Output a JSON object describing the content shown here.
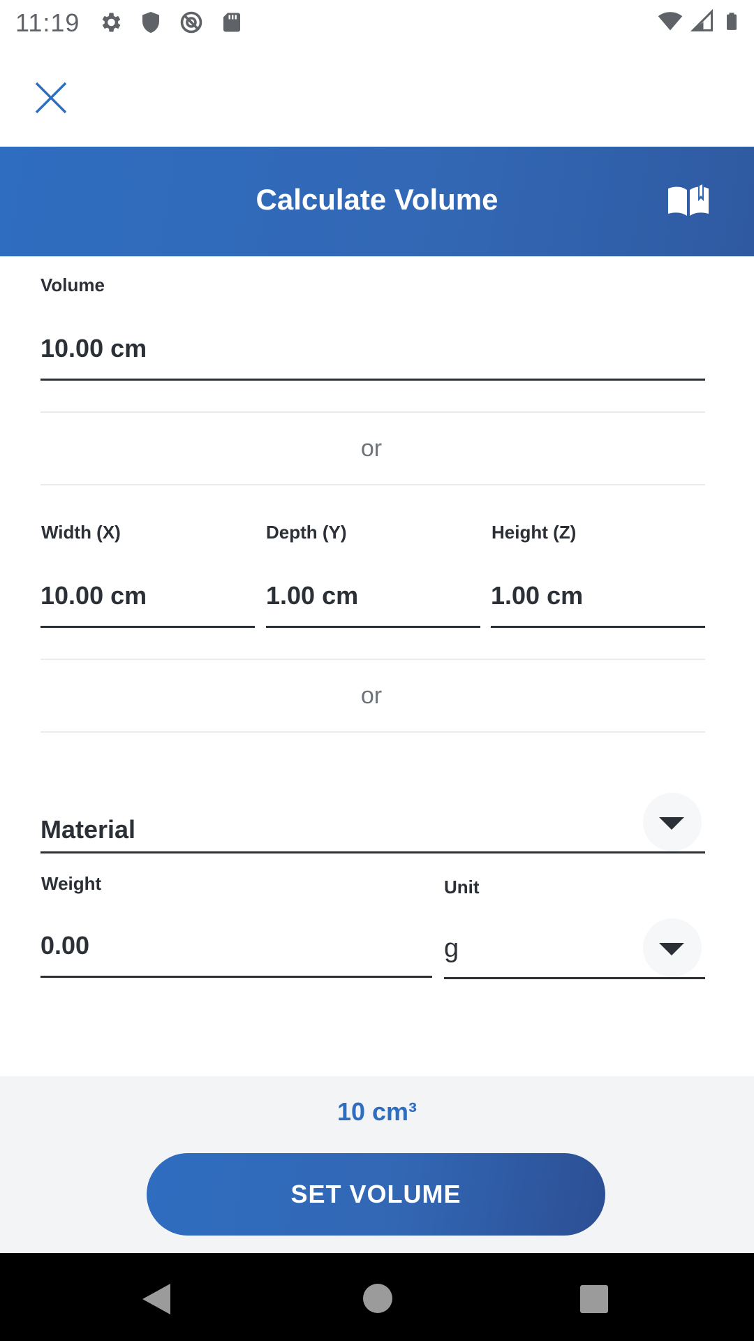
{
  "status_bar": {
    "time": "11:19",
    "left_icons": [
      "gear-icon",
      "shield-icon",
      "no-sync-icon",
      "sd-card-icon"
    ],
    "right_icons": [
      "wifi-icon",
      "signal-icon",
      "battery-icon"
    ]
  },
  "header": {
    "title": "Calculate Volume",
    "close_icon": "close-icon",
    "book_icon": "book-icon"
  },
  "volume": {
    "label": "Volume",
    "value": "10.00 cm"
  },
  "separators": {
    "or_1": "or",
    "or_2": "or"
  },
  "dimensions": {
    "width": {
      "label": "Width (X)",
      "value": "10.00 cm"
    },
    "depth": {
      "label": "Depth (Y)",
      "value": "1.00 cm"
    },
    "height": {
      "label": "Height (Z)",
      "value": "1.00 cm"
    }
  },
  "material": {
    "placeholder": "Material"
  },
  "weight": {
    "label": "Weight",
    "value": "0.00"
  },
  "unit": {
    "label": "Unit",
    "value": "g"
  },
  "footer": {
    "result": "10 cm³",
    "button_label": "SET VOLUME"
  },
  "colors": {
    "accent": "#2f6dc0",
    "text": "#2b2f36",
    "footer_bg": "#f3f4f6"
  }
}
